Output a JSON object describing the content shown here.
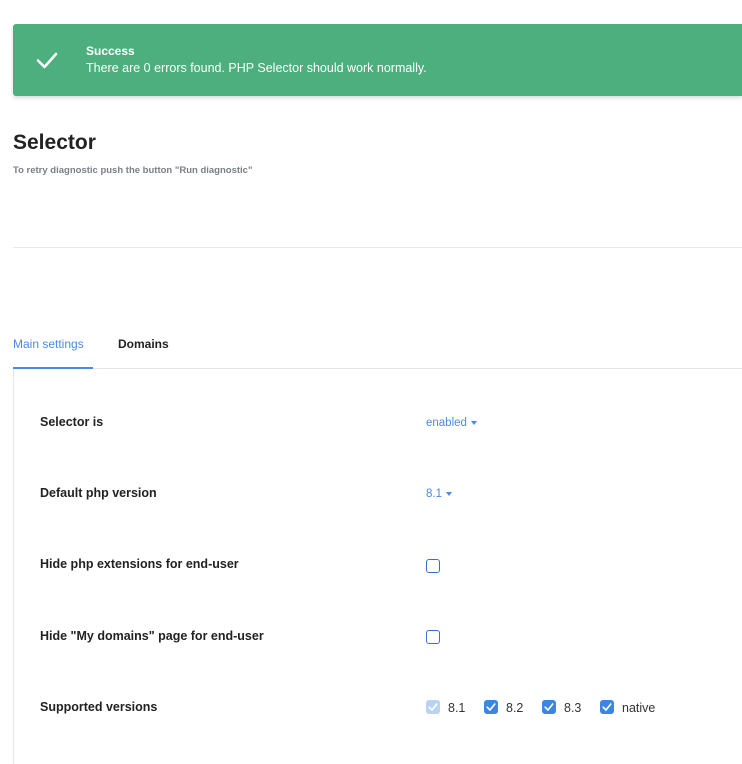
{
  "alert": {
    "title": "Success",
    "message": "There are 0 errors found. PHP Selector should work normally.",
    "icon": "check-icon",
    "color": "#4caf7d"
  },
  "header": {
    "title": "Selector",
    "subtitle": "To retry diagnostic push the button \"Run diagnostic\""
  },
  "tabs": [
    {
      "label": "Main settings",
      "active": true
    },
    {
      "label": "Domains",
      "active": false
    }
  ],
  "settings": {
    "selector": {
      "label": "Selector is",
      "value": "enabled"
    },
    "default_version": {
      "label": "Default php version",
      "value": "8.1"
    },
    "hide_extensions": {
      "label": "Hide php extensions for end-user",
      "checked": false
    },
    "hide_my_domains": {
      "label": "Hide \"My domains\" page for end-user",
      "checked": false
    },
    "supported_versions": {
      "label": "Supported versions",
      "items": [
        {
          "label": "8.1",
          "checked": true,
          "disabled": true
        },
        {
          "label": "8.2",
          "checked": true,
          "disabled": false
        },
        {
          "label": "8.3",
          "checked": true,
          "disabled": false
        },
        {
          "label": "native",
          "checked": true,
          "disabled": false
        }
      ]
    }
  },
  "colors": {
    "accent": "#4a8ae6",
    "success": "#4caf7d"
  }
}
